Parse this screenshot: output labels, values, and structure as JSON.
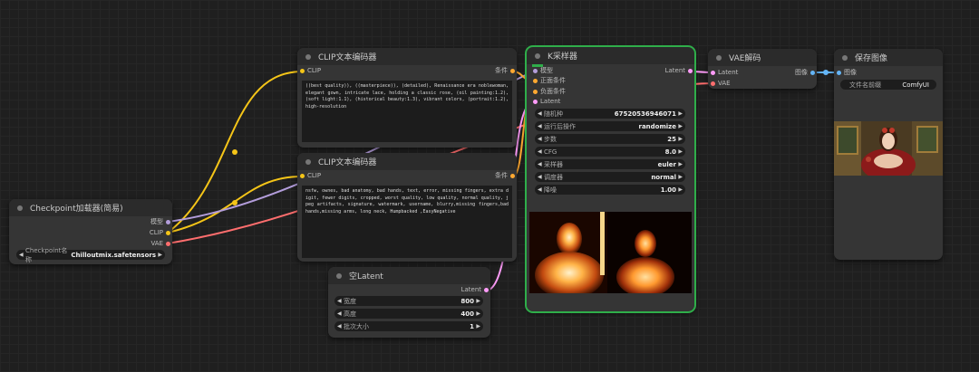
{
  "checkpoint_loader": {
    "title": "Checkpoint加载器(简易)",
    "outputs": [
      "模型",
      "CLIP",
      "VAE"
    ],
    "ckpt_label": "Checkpoint名称",
    "ckpt_value": "Chilloutmix.safetensors"
  },
  "clip_positive": {
    "title": "CLIP文本编码器",
    "input": "CLIP",
    "output": "条件",
    "text": "((best quality)), ((masterpiece)), (detailed), Renaissance era noblewoman, elegant gown, intricate lace, holding a classic rose, (oil painting:1.2), (soft light:1.1), (historical beauty:1.3), vibrant colors, (portrait:1.2), high-resolution"
  },
  "clip_negative": {
    "title": "CLIP文本编码器",
    "input": "CLIP",
    "output": "条件",
    "text": "nsfw, ownes, bad anatomy, bad hands, text, error, missing fingers, extra digit, fewer digits, cropped, worst quality, low quality, normal quality, jpeg artifacts, signature, watermark, username, blurry,missing fingers,bad hands,missing arms, long neck, Humpbacked ,EasyNegative"
  },
  "empty_latent": {
    "title": "空Latent",
    "output": "Latent",
    "widgets": [
      {
        "label": "宽度",
        "value": "800"
      },
      {
        "label": "高度",
        "value": "400"
      },
      {
        "label": "批次大小",
        "value": "1"
      }
    ]
  },
  "ksampler": {
    "title": "K采样器",
    "inputs": [
      "模型",
      "正面条件",
      "负面条件",
      "Latent"
    ],
    "output": "Latent",
    "widgets": [
      {
        "label": "随机种",
        "value": "675205369460​71"
      },
      {
        "label": "运行后操作",
        "value": "randomize"
      },
      {
        "label": "步数",
        "value": "25"
      },
      {
        "label": "CFG",
        "value": "8.0"
      },
      {
        "label": "采样器",
        "value": "euler"
      },
      {
        "label": "调度器",
        "value": "normal"
      },
      {
        "label": "降噪",
        "value": "1.00"
      }
    ]
  },
  "vae_decode": {
    "title": "VAE解码",
    "inputs": [
      "Latent",
      "VAE"
    ],
    "output": "图像"
  },
  "save_image": {
    "title": "保存图像",
    "input": "图像",
    "prefix_label": "文件名前缀",
    "prefix_value": "ComfyUI"
  },
  "colors": {
    "model": "#b39ddb",
    "clip": "#f5c518",
    "vae": "#ff6e6e",
    "conditioning": "#ffa931",
    "latent": "#ff9cf9",
    "image": "#64b5f6",
    "selected": "#2fae4a"
  }
}
